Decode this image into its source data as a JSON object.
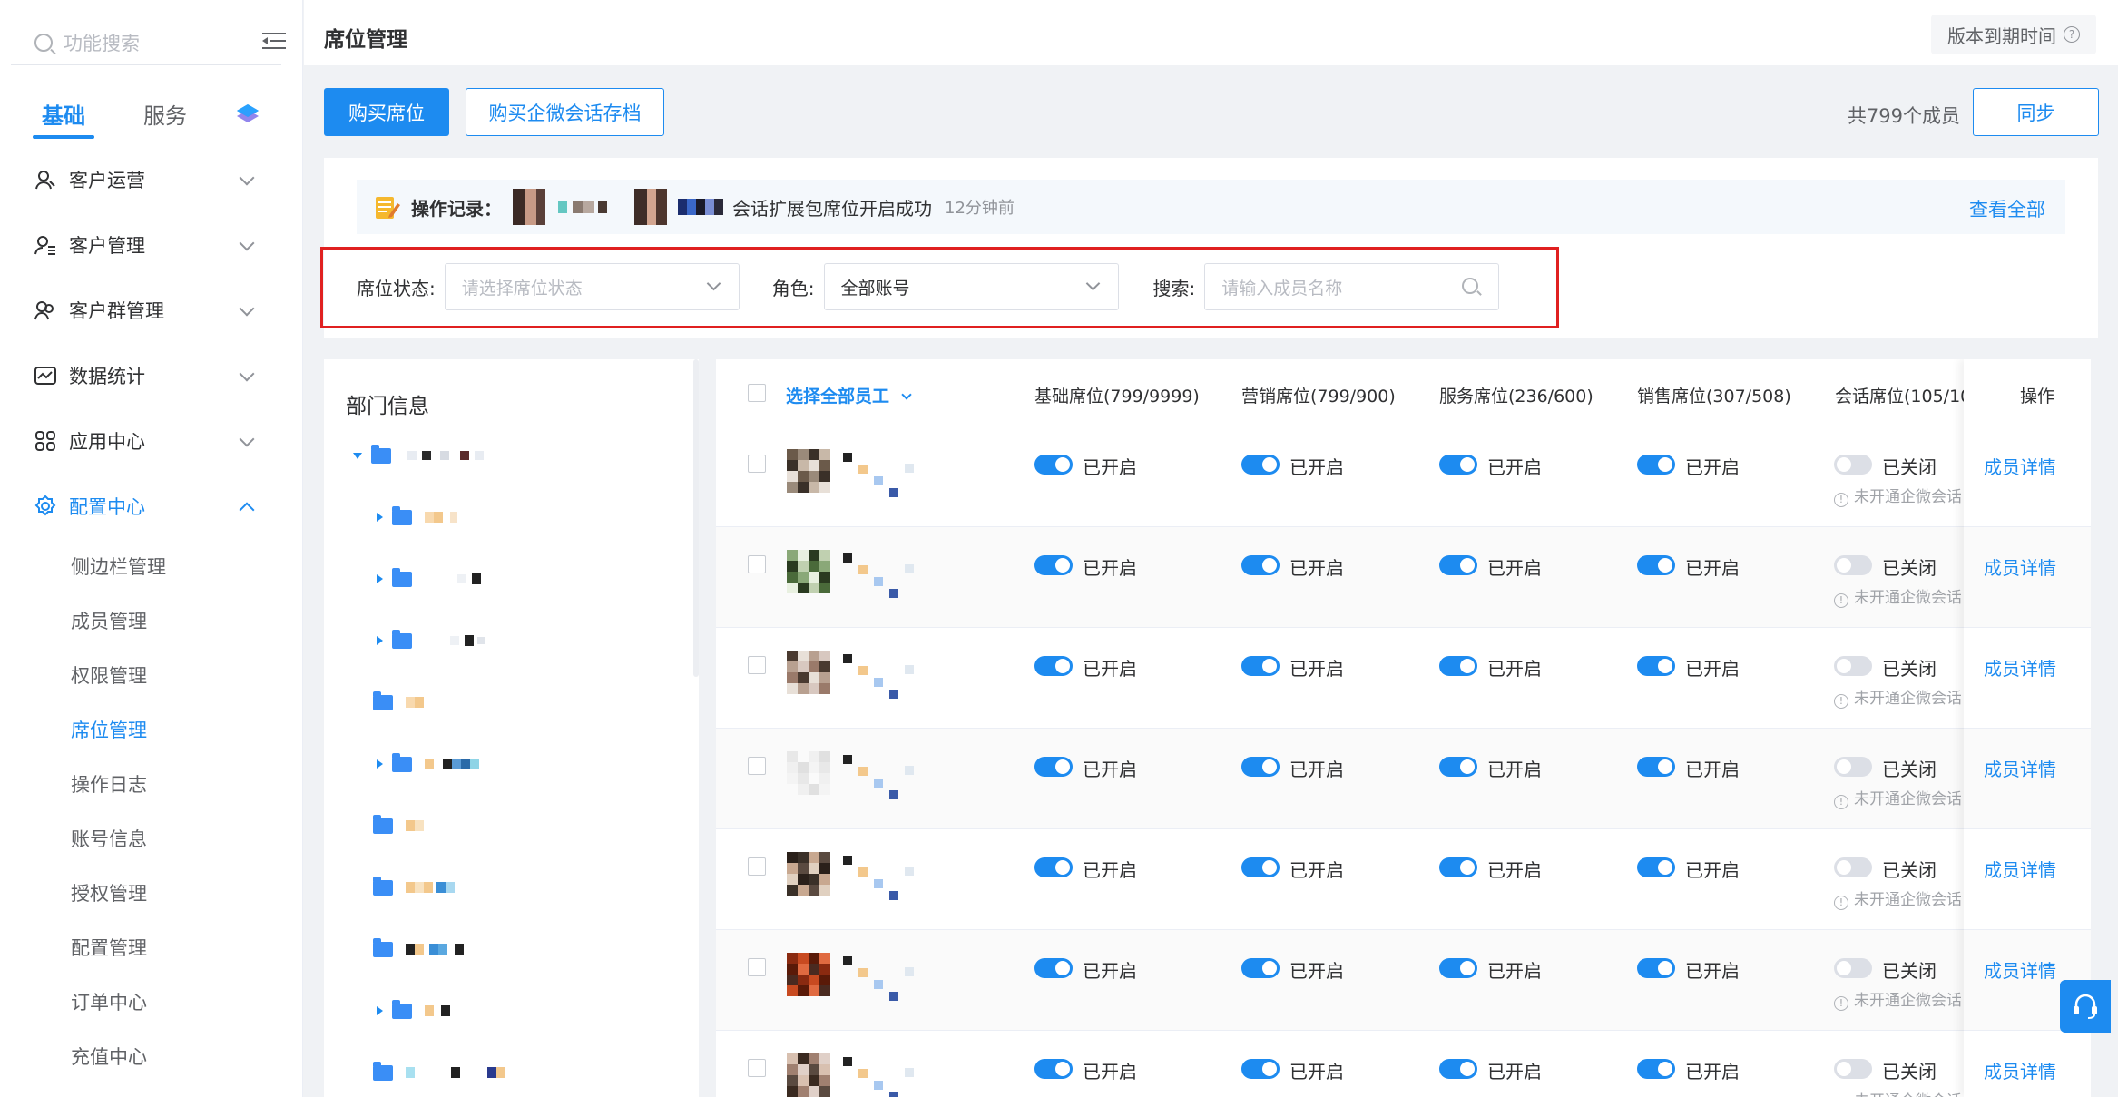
{
  "sidebar": {
    "search_placeholder": "功能搜索",
    "tabs": [
      "基础",
      "服务"
    ],
    "menu": [
      {
        "label": "客户运营",
        "icon": "user-operation-icon"
      },
      {
        "label": "客户管理",
        "icon": "user-list-icon"
      },
      {
        "label": "客户群管理",
        "icon": "group-icon"
      },
      {
        "label": "数据统计",
        "icon": "chart-icon"
      },
      {
        "label": "应用中心",
        "icon": "apps-icon"
      },
      {
        "label": "配置中心",
        "icon": "gear-icon"
      }
    ],
    "submenu": [
      "侧边栏管理",
      "成员管理",
      "权限管理",
      "席位管理",
      "操作日志",
      "账号信息",
      "授权管理",
      "配置管理",
      "订单中心",
      "充值中心"
    ]
  },
  "header": {
    "title": "席位管理",
    "expire_label": "版本到期时间"
  },
  "actions": {
    "buy_seat": "购买席位",
    "buy_archive": "购买企微会话存档",
    "member_count": "共799个成员",
    "sync": "同步"
  },
  "op_record": {
    "label": "操作记录：",
    "text": "会话扩展包席位开启成功",
    "time": "12分钟前",
    "view_all": "查看全部"
  },
  "filters": {
    "status_label": "席位状态:",
    "status_placeholder": "请选择席位状态",
    "role_label": "角色:",
    "role_value": "全部账号",
    "search_label": "搜索:",
    "search_placeholder": "请输入成员名称"
  },
  "dept": {
    "title": "部门信息"
  },
  "table": {
    "headers": {
      "select_all": "选择全部员工",
      "basic": "基础席位(799/9999)",
      "marketing": "营销席位(799/900)",
      "service": "服务席位(236/600)",
      "sales": "销售席位(307/508)",
      "session": "会话席位(105/10",
      "operation": "操作"
    },
    "on_label": "已开启",
    "off_label": "已关闭",
    "note": "未开通企微会话",
    "detail": "成员详情",
    "row_count": 7
  },
  "colors": {
    "primary": "#1d8bf0",
    "highlight": "#e02020"
  }
}
